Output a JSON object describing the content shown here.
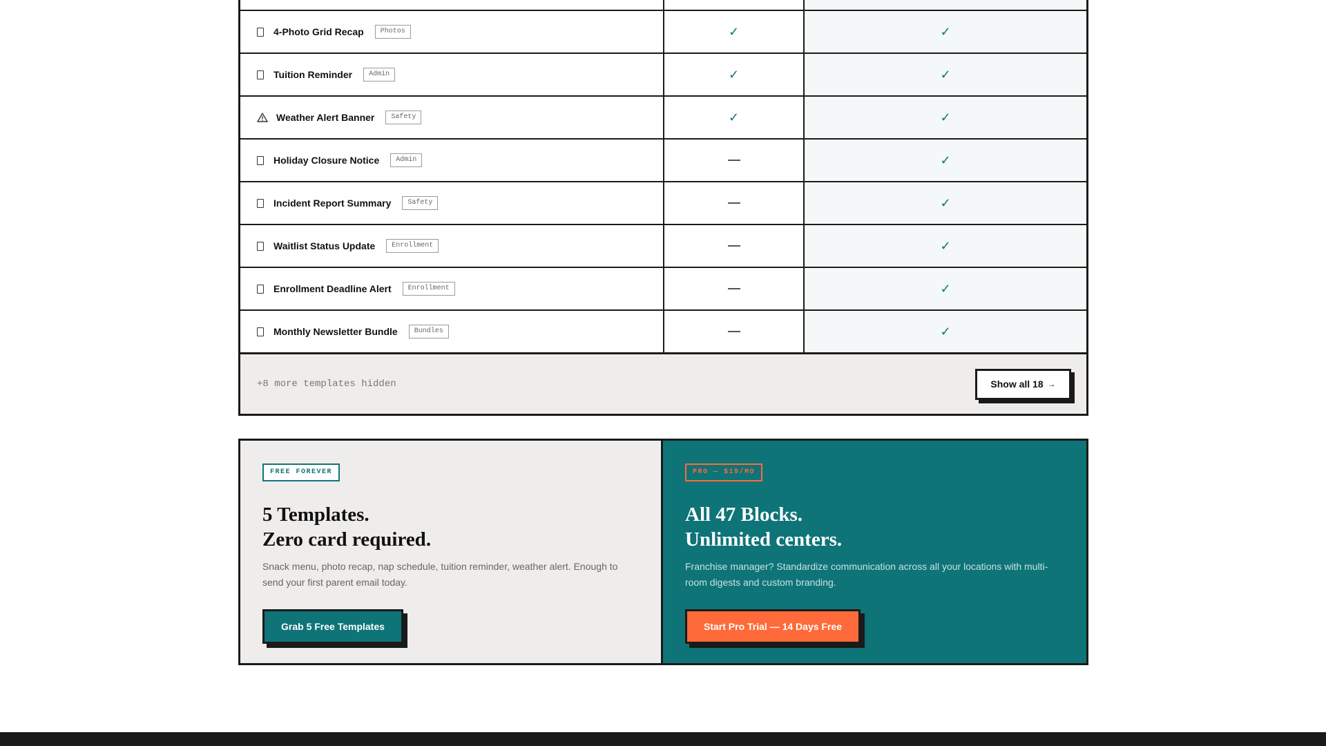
{
  "colors": {
    "accent_teal": "#0e7478",
    "accent_orange": "#ff6a3a",
    "border_dark": "#1a1a1a",
    "panel_light": "#efedeb"
  },
  "templates": [
    {
      "name": "4-Photo Grid Recap",
      "tag": "Photos",
      "icon": "document-icon",
      "basic": true,
      "pro": true
    },
    {
      "name": "Tuition Reminder",
      "tag": "Admin",
      "icon": "document-icon",
      "basic": true,
      "pro": true
    },
    {
      "name": "Weather Alert Banner",
      "tag": "Safety",
      "icon": "warning-icon",
      "basic": true,
      "pro": true
    },
    {
      "name": "Holiday Closure Notice",
      "tag": "Admin",
      "icon": "document-icon",
      "basic": false,
      "pro": true
    },
    {
      "name": "Incident Report Summary",
      "tag": "Safety",
      "icon": "document-icon",
      "basic": false,
      "pro": true
    },
    {
      "name": "Waitlist Status Update",
      "tag": "Enrollment",
      "icon": "document-icon",
      "basic": false,
      "pro": true
    },
    {
      "name": "Enrollment Deadline Alert",
      "tag": "Enrollment",
      "icon": "document-icon",
      "basic": false,
      "pro": true
    },
    {
      "name": "Monthly Newsletter Bundle",
      "tag": "Bundles",
      "icon": "document-icon",
      "basic": false,
      "pro": true
    }
  ],
  "table_footer": {
    "hidden_text": "+8 more templates hidden",
    "show_all_label": "Show all 18",
    "show_all_arrow": "→"
  },
  "plans": {
    "free": {
      "badge": "FREE FOREVER",
      "heading_line1": "5 Templates.",
      "heading_line2": "Zero card required.",
      "description": "Snack menu, photo recap, nap schedule, tuition reminder, weather alert. Enough to send your first parent email today.",
      "cta": "Grab 5 Free Templates"
    },
    "pro": {
      "badge": "PRO — $19/MO",
      "heading_line1": "All 47 Blocks.",
      "heading_line2": "Unlimited centers.",
      "description": "Franchise manager? Standardize communication across all your locations with multi-room digests and custom branding.",
      "cta": "Start Pro Trial — 14 Days Free"
    }
  }
}
